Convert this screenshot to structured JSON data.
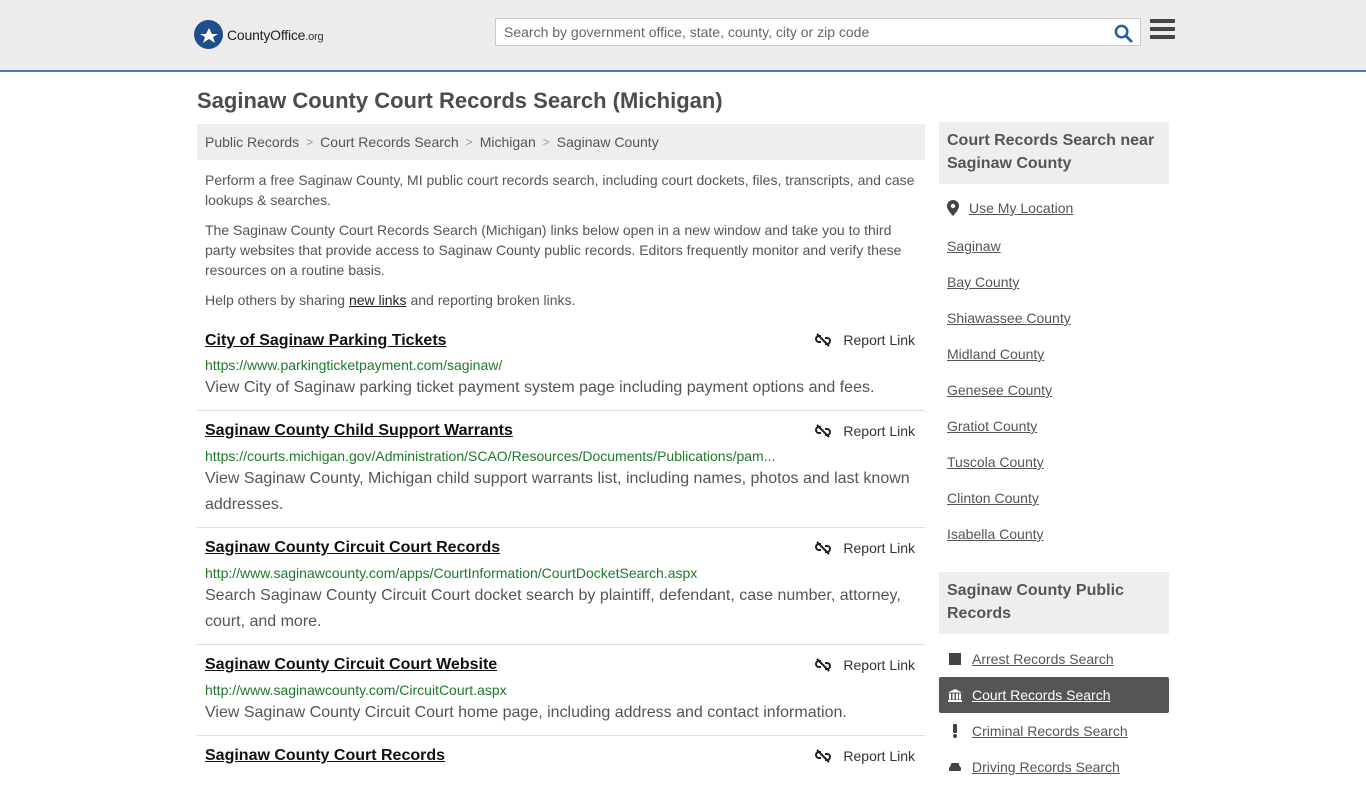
{
  "header": {
    "logo_name": "CountyOffice",
    "logo_tld": ".org",
    "search_placeholder": "Search by government office, state, county, city or zip code"
  },
  "page_title": "Saginaw County Court Records Search (Michigan)",
  "breadcrumb": [
    "Public Records",
    "Court Records Search",
    "Michigan",
    "Saginaw County"
  ],
  "intro": {
    "p1": "Perform a free Saginaw County, MI public court records search, including court dockets, files, transcripts, and case lookups & searches.",
    "p2": "The Saginaw County Court Records Search (Michigan) links below open in a new window and take you to third party websites that provide access to Saginaw County public records. Editors frequently monitor and verify these resources on a routine basis.",
    "p3_before": "Help others by sharing ",
    "p3_link": "new links",
    "p3_after": " and reporting broken links."
  },
  "report_label": "Report Link",
  "results": [
    {
      "title": "City of Saginaw Parking Tickets",
      "url": "https://www.parkingticketpayment.com/saginaw/",
      "desc": "View City of Saginaw parking ticket payment system page including payment options and fees."
    },
    {
      "title": "Saginaw County Child Support Warrants",
      "url": "https://courts.michigan.gov/Administration/SCAO/Resources/Documents/Publications/pam...",
      "desc": "View Saginaw County, Michigan child support warrants list, including names, photos and last known addresses."
    },
    {
      "title": "Saginaw County Circuit Court Records",
      "url": "http://www.saginawcounty.com/apps/CourtInformation/CourtDocketSearch.aspx",
      "desc": "Search Saginaw County Circuit Court docket search by plaintiff, defendant, case number, attorney, court, and more."
    },
    {
      "title": "Saginaw County Circuit Court Website",
      "url": "http://www.saginawcounty.com/CircuitCourt.aspx",
      "desc": "View Saginaw County Circuit Court home page, including address and contact information."
    },
    {
      "title": "Saginaw County Court Records",
      "url": "",
      "desc": ""
    }
  ],
  "sidebar": {
    "near_title": "Court Records Search near Saginaw County",
    "use_location": "Use My Location",
    "near_links": [
      "Saginaw",
      "Bay County",
      "Shiawassee County",
      "Midland County",
      "Genesee County",
      "Gratiot County",
      "Tuscola County",
      "Clinton County",
      "Isabella County"
    ],
    "records_title": "Saginaw County Public Records",
    "records_links": [
      {
        "label": "Arrest Records Search",
        "icon": "square-icon"
      },
      {
        "label": "Court Records Search",
        "icon": "courthouse-icon"
      },
      {
        "label": "Criminal Records Search",
        "icon": "exclamation-icon"
      },
      {
        "label": "Driving Records Search",
        "icon": "car-icon"
      }
    ]
  },
  "colors": {
    "header_bg": "#ececec",
    "header_border": "#4a7ab5",
    "url_green": "#1d7a2a",
    "active_bg": "#555555"
  }
}
